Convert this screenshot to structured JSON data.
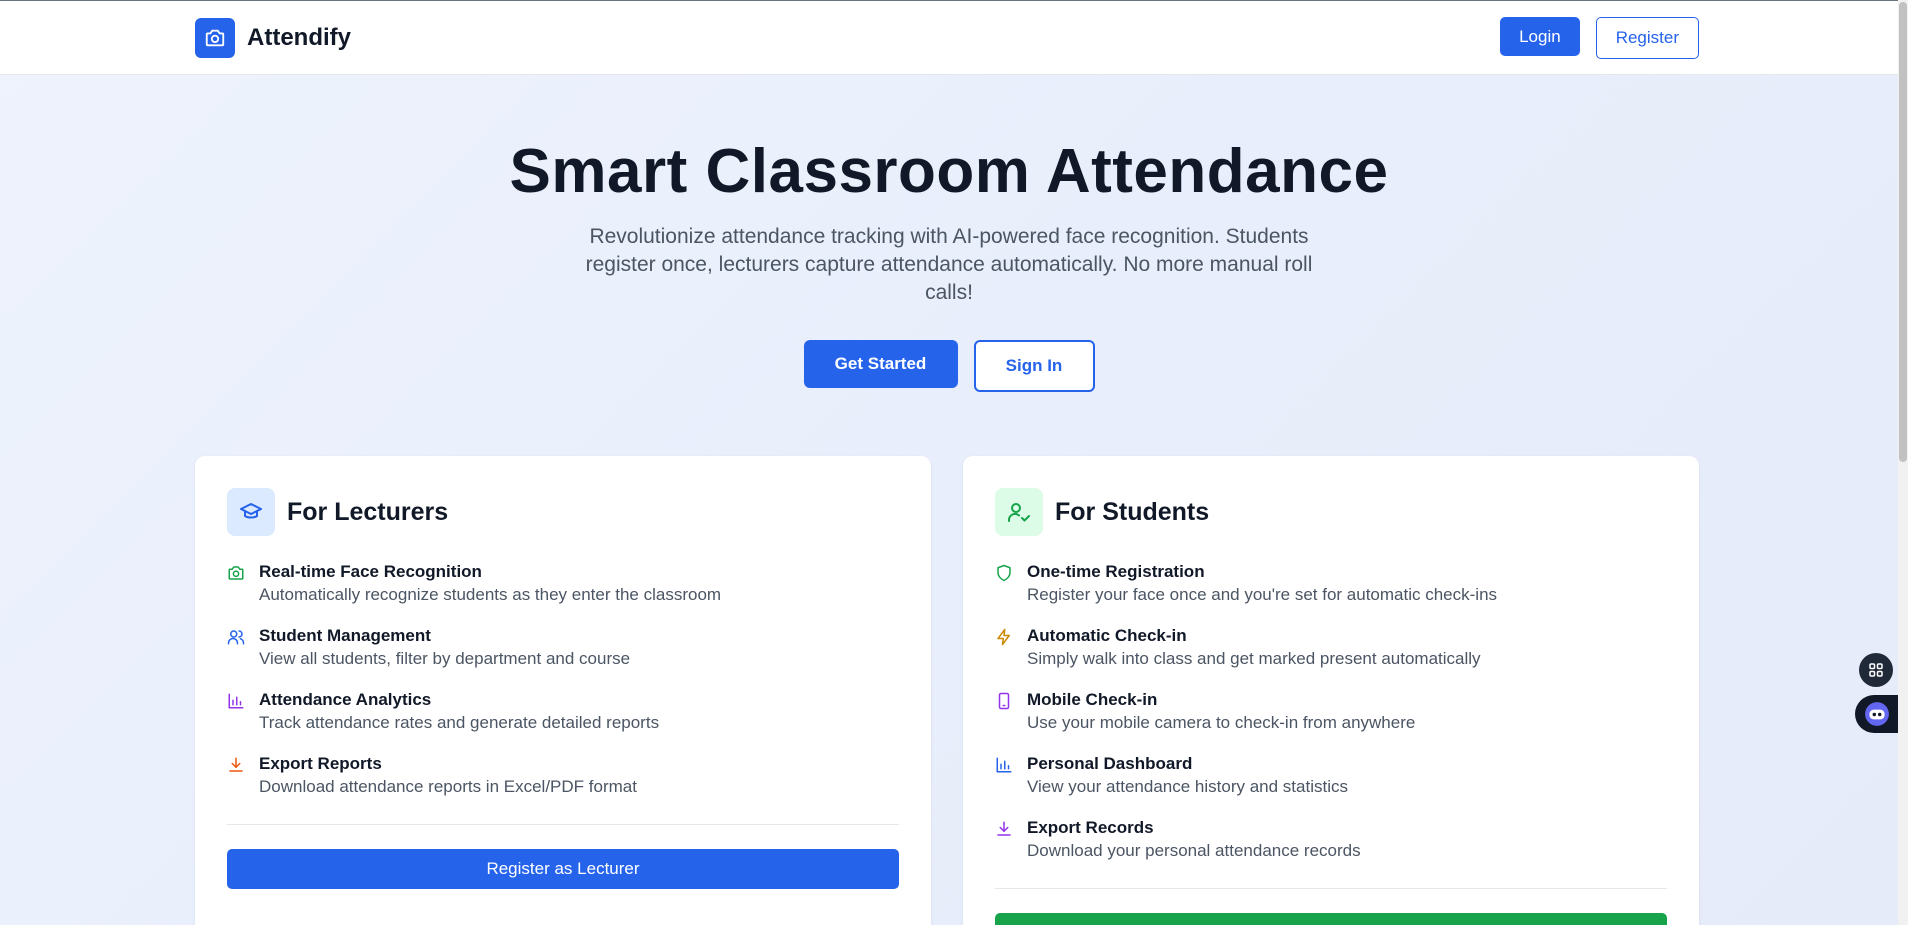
{
  "header": {
    "brand": "Attendify",
    "login_label": "Login",
    "register_label": "Register"
  },
  "hero": {
    "title": "Smart Classroom Attendance",
    "subtitle": "Revolutionize attendance tracking with AI-powered face recognition. Students register once, lecturers capture attendance automatically. No more manual roll calls!",
    "primary_label": "Get Started",
    "secondary_label": "Sign In"
  },
  "lecturers": {
    "title": "For Lecturers",
    "features": [
      {
        "title": "Real-time Face Recognition",
        "desc": "Automatically recognize students as they enter the classroom",
        "icon": "camera-icon"
      },
      {
        "title": "Student Management",
        "desc": "View all students, filter by department and course",
        "icon": "users-icon"
      },
      {
        "title": "Attendance Analytics",
        "desc": "Track attendance rates and generate detailed reports",
        "icon": "bar-chart-icon"
      },
      {
        "title": "Export Reports",
        "desc": "Download attendance reports in Excel/PDF format",
        "icon": "download-icon"
      }
    ],
    "cta_label": "Register as Lecturer"
  },
  "students": {
    "title": "For Students",
    "features": [
      {
        "title": "One-time Registration",
        "desc": "Register your face once and you're set for automatic check-ins",
        "icon": "shield-icon"
      },
      {
        "title": "Automatic Check-in",
        "desc": "Simply walk into class and get marked present automatically",
        "icon": "lightning-icon"
      },
      {
        "title": "Mobile Check-in",
        "desc": "Use your mobile camera to check-in from anywhere",
        "icon": "smartphone-icon"
      },
      {
        "title": "Personal Dashboard",
        "desc": "View your attendance history and statistics",
        "icon": "bar-chart-icon"
      },
      {
        "title": "Export Records",
        "desc": "Download your personal attendance records",
        "icon": "download-icon"
      }
    ]
  },
  "colors": {
    "primary": "#2563eb",
    "success": "#16a34a",
    "text": "#111827",
    "muted": "#4b5563"
  }
}
